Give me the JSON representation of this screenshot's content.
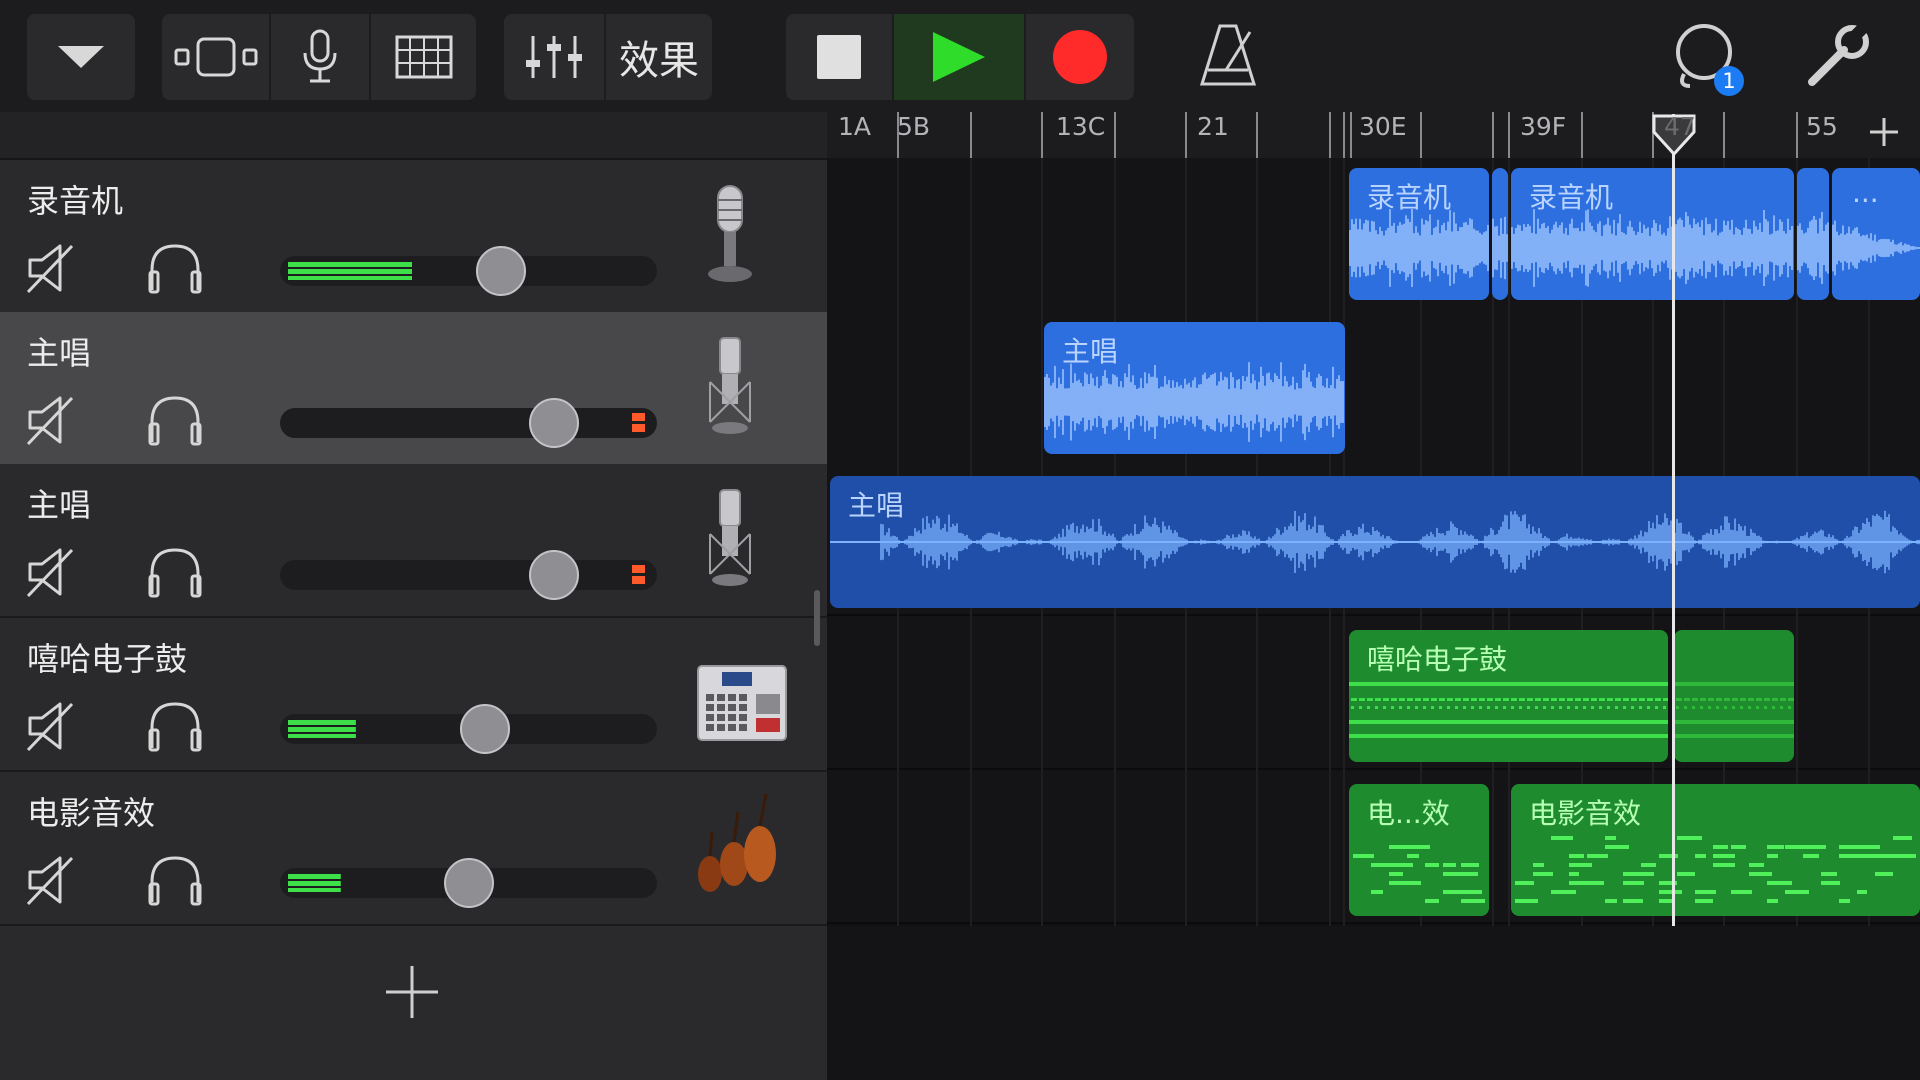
{
  "toolbar": {
    "effects_label": "效果",
    "notification_badge": "1",
    "play_color": "#2fdc2a",
    "record_color": "#ff2a2a"
  },
  "ruler": {
    "labels": [
      "1A",
      "5B",
      "13C",
      "21",
      "30E",
      "39F",
      "47",
      "55"
    ]
  },
  "tracks": [
    {
      "name": "录音机",
      "instrument": "mic-icon",
      "volume": 0.6,
      "meter_level": 0.33,
      "selected": false
    },
    {
      "name": "主唱",
      "instrument": "condenser-mic-icon",
      "volume": 0.76,
      "meter_level": 0,
      "peak": true,
      "selected": true
    },
    {
      "name": "主唱",
      "instrument": "condenser-mic-icon",
      "volume": 0.76,
      "meter_level": 0,
      "peak": true,
      "selected": false
    },
    {
      "name": "嘻哈电子鼓",
      "instrument": "drum-machine-icon",
      "volume": 0.55,
      "meter_level": 0.18,
      "selected": false
    },
    {
      "name": "电影音效",
      "instrument": "strings-icon",
      "volume": 0.5,
      "meter_level": 0.14,
      "selected": false
    }
  ],
  "regions": {
    "lane1": [
      "录音机",
      "录音机",
      "..."
    ],
    "lane2": [
      "主唱"
    ],
    "lane3": [
      "主唱"
    ],
    "lane4": [
      "嘻哈电子鼓"
    ],
    "lane5": [
      "电...效",
      "电影音效"
    ]
  },
  "playhead_label": "47"
}
